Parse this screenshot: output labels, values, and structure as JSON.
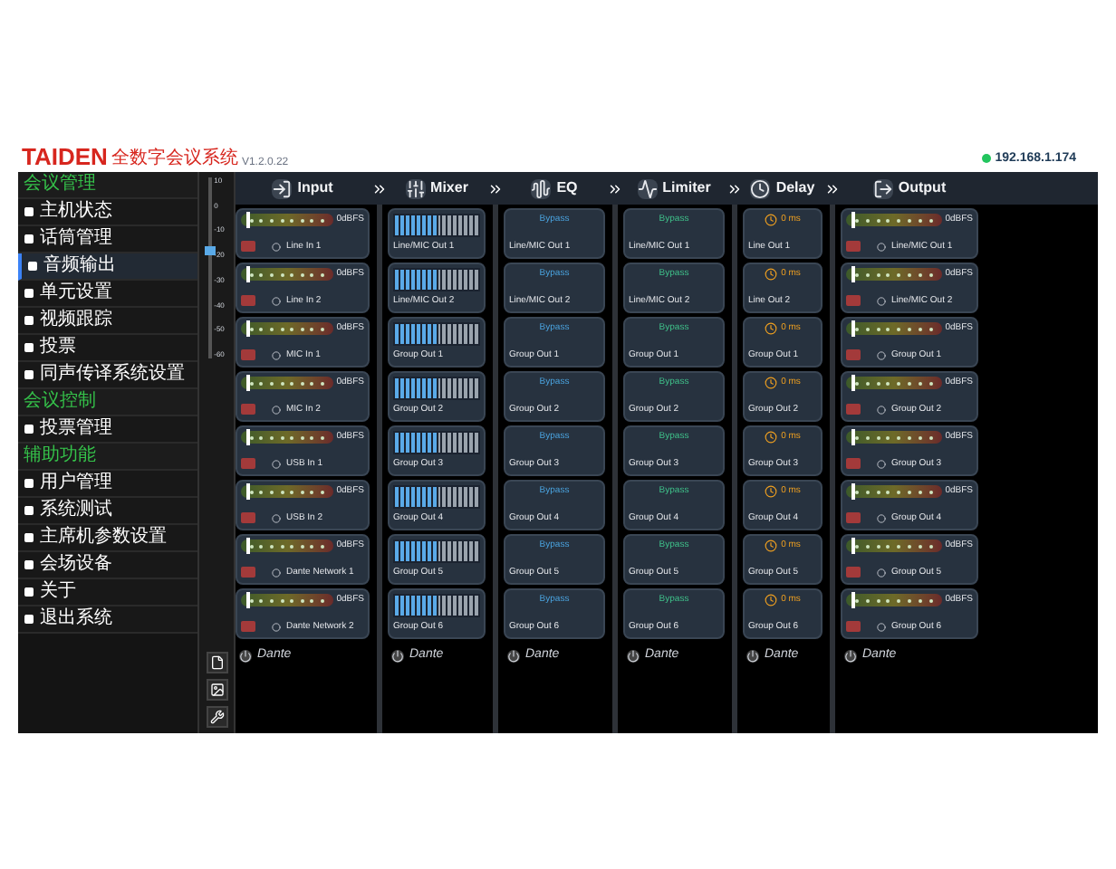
{
  "header": {
    "logo": "TAIDEN",
    "title": "全数字会议系统",
    "version": "V1.2.0.22",
    "ip": "192.168.1.174",
    "connected": true
  },
  "sidebar": [
    {
      "title": "会议管理",
      "items": [
        {
          "label": "主机状态",
          "selected": false
        },
        {
          "label": "话筒管理",
          "selected": false
        },
        {
          "label": "音频输出",
          "selected": true
        },
        {
          "label": "单元设置",
          "selected": false
        },
        {
          "label": "视频跟踪",
          "selected": false
        },
        {
          "label": "投票",
          "selected": false
        },
        {
          "label": "同声传译系统设置",
          "selected": false
        }
      ]
    },
    {
      "title": "会议控制",
      "items": [
        {
          "label": "投票管理",
          "selected": false
        }
      ]
    },
    {
      "title": "辅助功能",
      "items": [
        {
          "label": "用户管理",
          "selected": false
        },
        {
          "label": "系统测试",
          "selected": false
        },
        {
          "label": "主席机参数设置",
          "selected": false
        },
        {
          "label": "会场设备",
          "selected": false
        },
        {
          "label": "关于",
          "selected": false
        },
        {
          "label": "退出系统",
          "selected": false
        }
      ]
    }
  ],
  "fader": {
    "scale": [
      "10",
      "0",
      "-10",
      "-20",
      "-30",
      "-40",
      "-50",
      "-60"
    ],
    "level": 0.6
  },
  "stages": [
    {
      "kind": "input",
      "title": "Input",
      "footer": "Dante",
      "channels": [
        {
          "name": "Line In 1",
          "muted": true,
          "level": 0.05,
          "reading": "0dBFS"
        },
        {
          "name": "Line In 2",
          "muted": true,
          "level": 0.05,
          "reading": "0dBFS"
        },
        {
          "name": "MIC In 1",
          "muted": true,
          "level": 0.05,
          "reading": "0dBFS"
        },
        {
          "name": "MIC In 2",
          "muted": true,
          "level": 0.05,
          "reading": "0dBFS"
        },
        {
          "name": "USB In 1",
          "muted": true,
          "level": 0.05,
          "reading": "0dBFS"
        },
        {
          "name": "USB In 2",
          "muted": true,
          "level": 0.05,
          "reading": "0dBFS"
        },
        {
          "name": "Dante Network 1",
          "muted": true,
          "level": 0.05,
          "reading": "0dBFS"
        },
        {
          "name": "Dante Network 2",
          "muted": true,
          "level": 0.05,
          "reading": "0dBFS"
        }
      ]
    },
    {
      "kind": "mixer",
      "title": "Mixer",
      "footer": "Dante",
      "channels": [
        {
          "name": "Line/MIC Out 1",
          "level": 0.5
        },
        {
          "name": "Line/MIC Out 2",
          "level": 0.5
        },
        {
          "name": "Group Out 1",
          "level": 0.5
        },
        {
          "name": "Group Out 2",
          "level": 0.5
        },
        {
          "name": "Group Out 3",
          "level": 0.5
        },
        {
          "name": "Group Out 4",
          "level": 0.5
        },
        {
          "name": "Group Out 5",
          "level": 0.5
        },
        {
          "name": "Group Out 6",
          "level": 0.5
        }
      ]
    },
    {
      "kind": "eq",
      "title": "EQ",
      "footer": "Dante",
      "channels": [
        {
          "name": "Line/MIC Out 1",
          "state": "Bypass"
        },
        {
          "name": "Line/MIC Out 2",
          "state": "Bypass"
        },
        {
          "name": "Group Out 1",
          "state": "Bypass"
        },
        {
          "name": "Group Out 2",
          "state": "Bypass"
        },
        {
          "name": "Group Out 3",
          "state": "Bypass"
        },
        {
          "name": "Group Out 4",
          "state": "Bypass"
        },
        {
          "name": "Group Out 5",
          "state": "Bypass"
        },
        {
          "name": "Group Out 6",
          "state": "Bypass"
        }
      ]
    },
    {
      "kind": "limiter",
      "title": "Limiter",
      "footer": "Dante",
      "channels": [
        {
          "name": "Line/MIC Out 1",
          "state": "Bypass"
        },
        {
          "name": "Line/MIC Out 2",
          "state": "Bypass"
        },
        {
          "name": "Group Out 1",
          "state": "Bypass"
        },
        {
          "name": "Group Out 2",
          "state": "Bypass"
        },
        {
          "name": "Group Out 3",
          "state": "Bypass"
        },
        {
          "name": "Group Out 4",
          "state": "Bypass"
        },
        {
          "name": "Group Out 5",
          "state": "Bypass"
        },
        {
          "name": "Group Out 6",
          "state": "Bypass"
        }
      ]
    },
    {
      "kind": "delay",
      "title": "Delay",
      "footer": "Dante",
      "channels": [
        {
          "name": "Line Out 1",
          "delay": "0 ms"
        },
        {
          "name": "Line Out 2",
          "delay": "0 ms"
        },
        {
          "name": "Group Out 1",
          "delay": "0 ms"
        },
        {
          "name": "Group Out 2",
          "delay": "0 ms"
        },
        {
          "name": "Group Out 3",
          "delay": "0 ms"
        },
        {
          "name": "Group Out 4",
          "delay": "0 ms"
        },
        {
          "name": "Group Out 5",
          "delay": "0 ms"
        },
        {
          "name": "Group Out 6",
          "delay": "0 ms"
        }
      ]
    },
    {
      "kind": "output",
      "title": "Output",
      "footer": "Dante",
      "channels": [
        {
          "name": "Line/MIC Out 1",
          "muted": true,
          "level": 0.05,
          "reading": "0dBFS"
        },
        {
          "name": "Line/MIC Out 2",
          "muted": true,
          "level": 0.05,
          "reading": "0dBFS"
        },
        {
          "name": "Group Out 1",
          "muted": true,
          "level": 0.05,
          "reading": "0dBFS"
        },
        {
          "name": "Group Out 2",
          "muted": true,
          "level": 0.05,
          "reading": "0dBFS"
        },
        {
          "name": "Group Out 3",
          "muted": true,
          "level": 0.05,
          "reading": "0dBFS"
        },
        {
          "name": "Group Out 4",
          "muted": true,
          "level": 0.05,
          "reading": "0dBFS"
        },
        {
          "name": "Group Out 5",
          "muted": true,
          "level": 0.05,
          "reading": "0dBFS"
        },
        {
          "name": "Group Out 6",
          "muted": true,
          "level": 0.05,
          "reading": "0dBFS"
        }
      ]
    }
  ]
}
